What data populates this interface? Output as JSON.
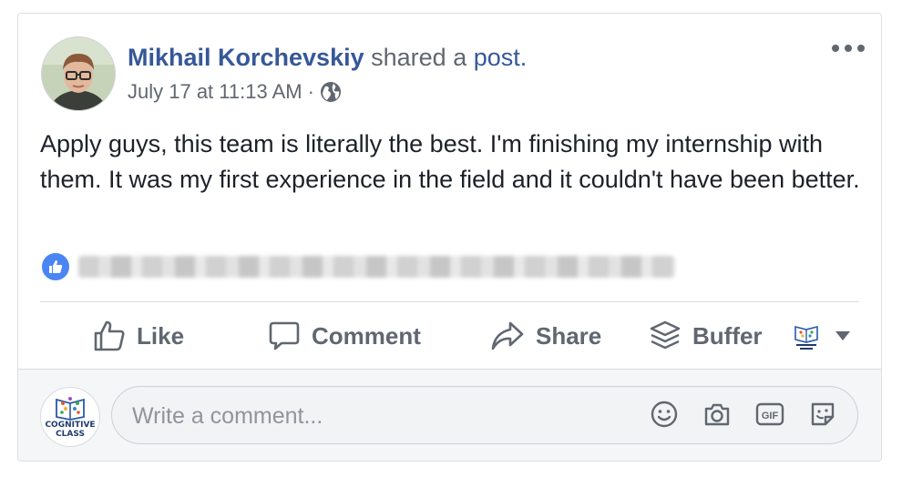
{
  "post": {
    "author": "Mikhail Korchevskiy",
    "shared_text": "shared a",
    "shared_link": "post.",
    "timestamp": "July 17 at 11:13 AM",
    "separator": "·",
    "privacy_icon": "globe-icon",
    "more_icon": "more-options-icon",
    "text": "Apply guys, this team is literally the best. I'm finishing my internship with them. It was my first experience in the field and it couldn't have been better."
  },
  "reactions": {
    "icon": "like-badge-icon"
  },
  "actions": {
    "like": "Like",
    "comment": "Comment",
    "share": "Share",
    "buffer": "Buffer"
  },
  "page_avatar": {
    "line1": "COGNITIVE",
    "line2": "CLASS"
  },
  "comment": {
    "placeholder": "Write a comment...",
    "value": "",
    "icons": [
      "emoji-icon",
      "camera-icon",
      "gif-icon",
      "sticker-icon"
    ]
  },
  "colors": {
    "link": "#365899",
    "muted": "#616770",
    "like_blue": "#4a86f3",
    "divider": "#dadde1"
  }
}
